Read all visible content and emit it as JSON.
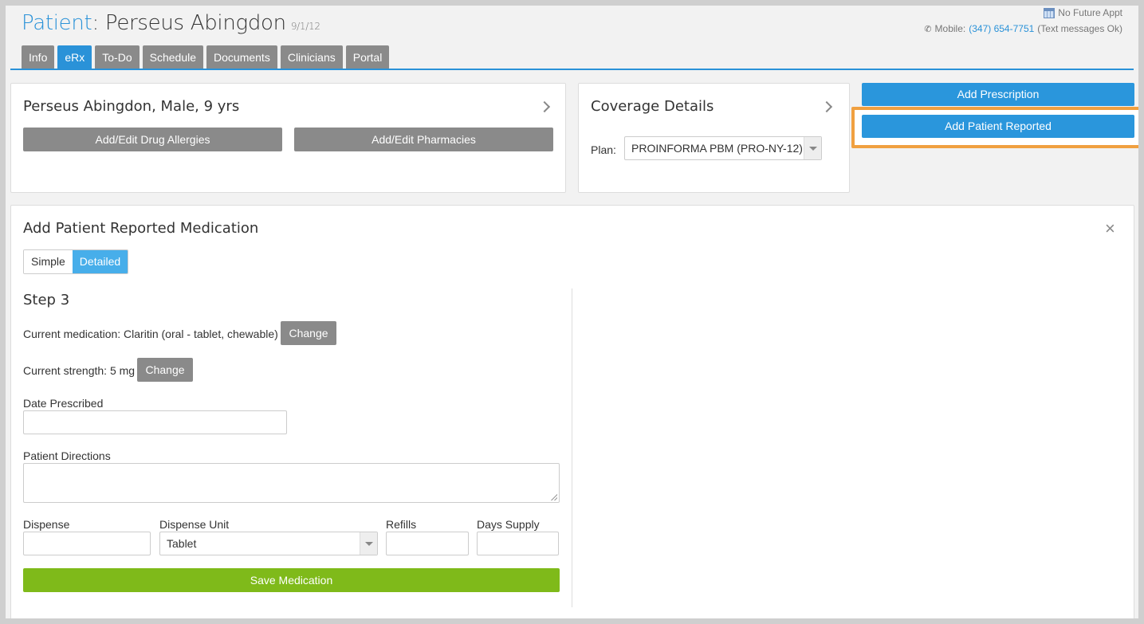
{
  "header": {
    "title_label": "Patient",
    "title_sep": ": ",
    "patient_name": "Perseus Abingdon",
    "dob": "9/1/12",
    "appt": "No Future Appt",
    "mobile_label": "Mobile:",
    "mobile_number": "(347) 654-7751",
    "mobile_note": "(Text messages Ok)"
  },
  "tabs": [
    {
      "label": "Info"
    },
    {
      "label": "eRx",
      "active": true
    },
    {
      "label": "To-Do"
    },
    {
      "label": "Schedule"
    },
    {
      "label": "Documents"
    },
    {
      "label": "Clinicians"
    },
    {
      "label": "Portal"
    }
  ],
  "patient_card": {
    "summary": "Perseus Abingdon, Male, 9 yrs",
    "allergies_button": "Add/Edit Drug Allergies",
    "pharmacies_button": "Add/Edit Pharmacies"
  },
  "coverage_card": {
    "title": "Coverage Details",
    "plan_label": "Plan:",
    "plan_value": "PROINFORMA PBM (PRO-NY-12)"
  },
  "actions": {
    "add_prescription": "Add Prescription",
    "add_patient_reported": "Add Patient Reported"
  },
  "form": {
    "title": "Add Patient Reported Medication",
    "close": "×",
    "mode_simple": "Simple",
    "mode_detailed": "Detailed",
    "step": "Step 3",
    "current_medication": "Current medication: Claritin (oral - tablet, chewable)",
    "current_strength": "Current strength: 5 mg",
    "change": "Change",
    "date_prescribed_label": "Date Prescribed",
    "date_prescribed_value": "",
    "directions_label": "Patient Directions",
    "directions_value": "",
    "dispense_label": "Dispense",
    "dispense_value": "",
    "dispense_unit_label": "Dispense Unit",
    "dispense_unit_value": "Tablet",
    "refills_label": "Refills",
    "refills_value": "",
    "days_supply_label": "Days Supply",
    "days_supply_value": "",
    "save": "Save Medication"
  },
  "colors": {
    "accent": "#2a92d8",
    "highlight": "#f0a040",
    "save": "#7fba1a",
    "gray_button": "#8a8a8a"
  }
}
